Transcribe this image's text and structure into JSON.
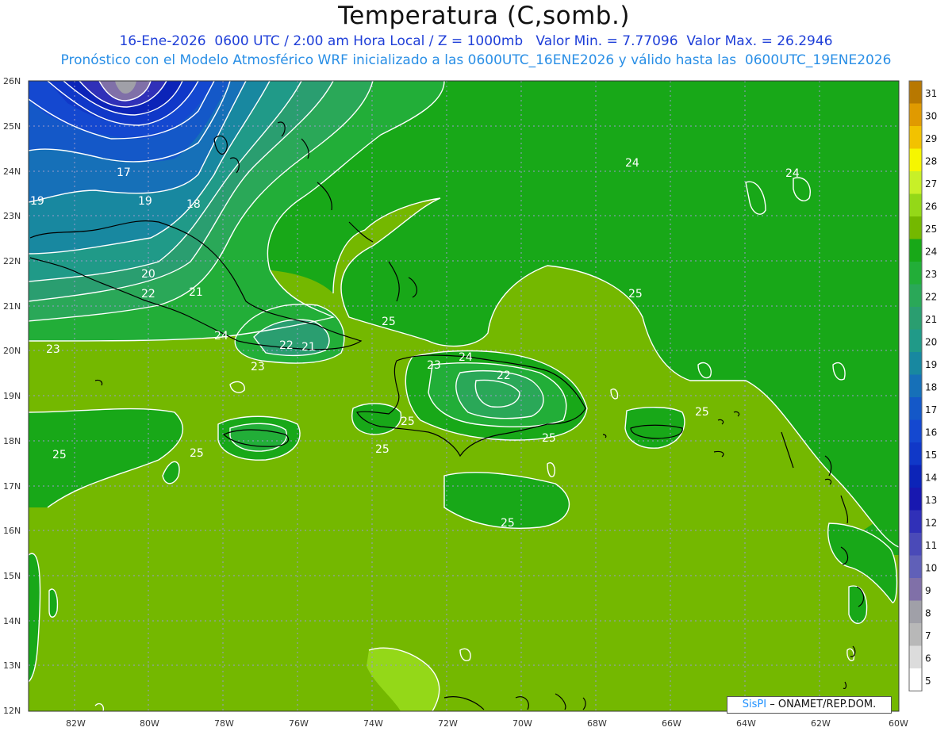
{
  "header": {
    "title": "Temperatura (C,somb.)",
    "subtitle1": "16-Ene-2026  0600 UTC / 2:00 am Hora Local / Z = 1000mb   Valor Min. = 7.77096  Valor Max. = 26.2946",
    "subtitle2": "Pronóstico con el Modelo Atmosférico WRF inicializado a las 0600UTC_16ENE2026 y válido hasta las  0600UTC_19ENE2026"
  },
  "lat_labels": [
    "26N",
    "25N",
    "24N",
    "23N",
    "22N",
    "21N",
    "20N",
    "19N",
    "18N",
    "17N",
    "16N",
    "15N",
    "14N",
    "13N",
    "12N"
  ],
  "lon_labels": [
    "82W",
    "80W",
    "78W",
    "76W",
    "74W",
    "72W",
    "70W",
    "68W",
    "66W",
    "64W",
    "62W",
    "60W"
  ],
  "colorbar": {
    "labels": [
      "31",
      "30",
      "29",
      "28",
      "27",
      "26",
      "25",
      "24",
      "23",
      "22",
      "21",
      "20",
      "19",
      "18",
      "17",
      "16",
      "15",
      "14",
      "13",
      "12",
      "11",
      "10",
      "9",
      "8",
      "7",
      "6",
      "5"
    ],
    "colors": [
      "#b87800",
      "#e09a00",
      "#f2c200",
      "#f6f600",
      "#c8f028",
      "#94d818",
      "#74b800",
      "#18a818",
      "#22ae38",
      "#2aa858",
      "#2a9e70",
      "#209a88",
      "#1888a0",
      "#1670b8",
      "#1458c8",
      "#1448d0",
      "#1038c8",
      "#0c24b8",
      "#1818b0",
      "#3030b8",
      "#4a4ab8",
      "#6060b8",
      "#8070a8",
      "#a0a0a8",
      "#b8b8b8",
      "#dcdcdc",
      "#ffffff"
    ]
  },
  "contour_labels": [
    "17",
    "18",
    "19",
    "19",
    "20",
    "21",
    "22",
    "23",
    "24",
    "22",
    "21",
    "23",
    "25",
    "24",
    "24",
    "25",
    "23",
    "24",
    "22",
    "25",
    "25",
    "25",
    "25",
    "25",
    "25",
    "25"
  ],
  "credit": {
    "brand": "SisPI",
    "text": " – ONAMET/REP.DOM."
  },
  "colors": {
    "background_ocean": "#18a818",
    "land_warm": "#74b800",
    "cold_core": "#1818b0",
    "contour_line": "#ffffff",
    "coastline": "#000000",
    "title_blue": "#1f3fd8",
    "subtitle_blue": "#2a8fe6"
  }
}
